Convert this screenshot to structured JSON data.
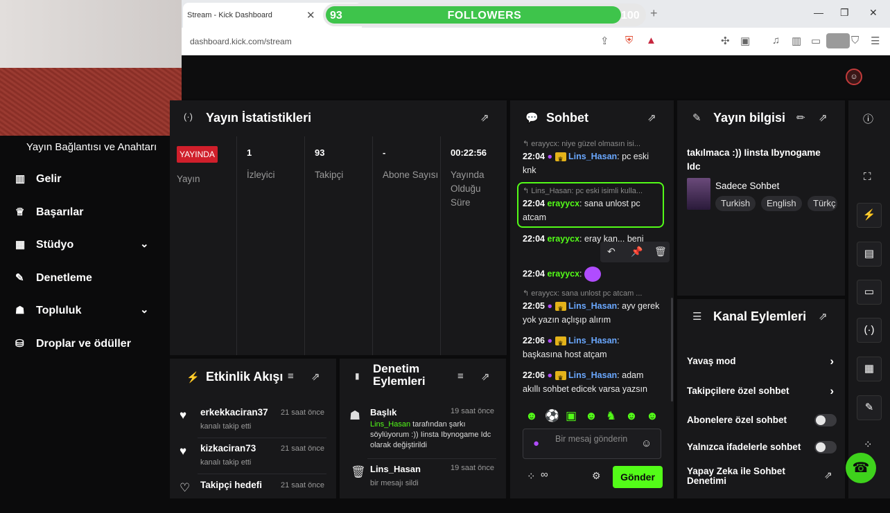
{
  "browser": {
    "tab_title": "Stream - Kick Dashboard",
    "url": "dashboard.kick.com/stream"
  },
  "followers_bar": {
    "start": "93",
    "label": "FOLLOWERS",
    "goal": "100",
    "progress_percent": 93
  },
  "sidebar": {
    "header": "Yayın Bağlantısı ve Anahtarı",
    "items": [
      {
        "label": "Gelir",
        "icon": "bar-chart-icon"
      },
      {
        "label": "Başarılar",
        "icon": "trophy-icon"
      },
      {
        "label": "Stüdyo",
        "icon": "studio-icon",
        "expandable": true
      },
      {
        "label": "Denetleme",
        "icon": "wrench-icon"
      },
      {
        "label": "Topluluk",
        "icon": "community-icon",
        "expandable": true
      },
      {
        "label": "Droplar ve ödüller",
        "icon": "drops-icon"
      }
    ]
  },
  "stats": {
    "title": "Yayın İstatistikleri",
    "live_badge": "YAYINDA",
    "columns": [
      {
        "value": "",
        "label": "Yayın"
      },
      {
        "value": "1",
        "label": "İzleyici"
      },
      {
        "value": "93",
        "label": "Takipçi"
      },
      {
        "value": "-",
        "label": "Abone Sayısı"
      },
      {
        "value": "00:22:56",
        "label": "Yayında Olduğu Süre"
      }
    ]
  },
  "activity": {
    "title": "Etkinlik Akışı",
    "items": [
      {
        "name": "erkekkaciran37",
        "sub": "kanalı takip etti",
        "time": "21 saat önce"
      },
      {
        "name": "kizkaciran73",
        "sub": "kanalı takip etti",
        "time": "21 saat önce"
      },
      {
        "name": "Takipçi hedefi",
        "sub": "",
        "time": "21 saat önce"
      }
    ]
  },
  "moderation": {
    "title": "Denetim Eylemleri",
    "items": [
      {
        "title": "Başlık",
        "time": "19 saat önce",
        "user": "Lins_Hasan",
        "text": "tarafından şarkı söylüyorum :)) Iinsta Ibynogame Idc olarak değiştirildi"
      },
      {
        "title": "Lins_Hasan",
        "time": "19 saat önce",
        "user": "",
        "text": "bir mesajı sildi"
      }
    ]
  },
  "chat": {
    "title": "Sohbet",
    "messages": [
      {
        "reply": "erayycx: niye güzel olmasın isi...",
        "time": "22:04",
        "user": "Lins_Hasan",
        "text": "pc eski knk",
        "color": "blue"
      },
      {
        "reply": "Lins_Hasan: pc eski isimli kulla...",
        "time": "22:04",
        "user": "erayycx",
        "text": "sana unlost pc atcam",
        "color": "green"
      },
      {
        "reply": "",
        "time": "22:04",
        "user": "erayycx",
        "text": "eray kan... beni",
        "color": "green"
      },
      {
        "reply": "",
        "time": "22:04",
        "user": "erayycx",
        "text": "",
        "color": "green"
      },
      {
        "reply": "erayycx: sana unlost pc atcam ...",
        "time": "22:05",
        "user": "Lins_Hasan",
        "text": "ayv gerek yok yazın açlışıp alırım",
        "color": "blue"
      },
      {
        "reply": "",
        "time": "22:06",
        "user": "Lins_Hasan",
        "text": "başkasına host atçam",
        "color": "blue"
      },
      {
        "reply": "",
        "time": "22:06",
        "user": "Lins_Hasan",
        "text": "adam akıllı sohbet edicek varsa yazsın",
        "color": "blue"
      }
    ],
    "input_placeholder": "Bir mesaj gönderin",
    "send_label": "Gönder",
    "footer_symbol": "∞"
  },
  "info": {
    "title": "Yayın bilgisi",
    "stream_title": "takılmaca :)) Iinsta Ibynogame Idc",
    "category": "Sadece Sohbet",
    "languages": [
      "Turkish",
      "English",
      "Türkç"
    ]
  },
  "channel": {
    "title": "Kanal Eylemleri",
    "rows": [
      {
        "label": "Yavaş mod",
        "control": "chevron"
      },
      {
        "label": "Takipçilere özel sohbet",
        "control": "chevron"
      },
      {
        "label": "Abonelere özel sohbet",
        "control": "toggle"
      },
      {
        "label": "Yalnızca ifadelerle sohbet",
        "control": "toggle"
      },
      {
        "label": "Yapay Zeka ile Sohbet Denetimi",
        "control": "chart"
      }
    ]
  },
  "colors": {
    "accent": "#53fc18",
    "live": "#d01f2b",
    "panel": "#18181a",
    "bg": "#0b0b0c",
    "user_blue": "#6aa8ff"
  }
}
